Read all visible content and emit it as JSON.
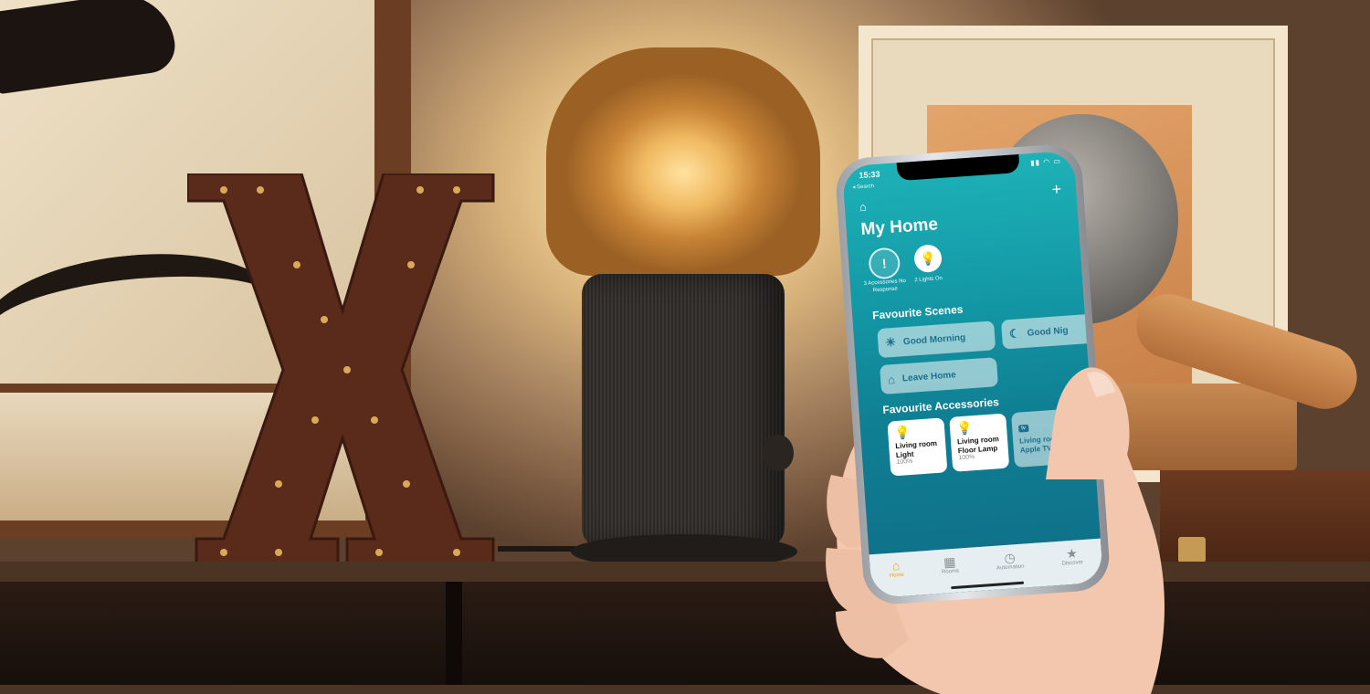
{
  "status_bar": {
    "time": "15:33",
    "back": "◂ Search"
  },
  "app": {
    "title": "My Home",
    "status": [
      {
        "caption": "3 Accessories No Response",
        "icon": "!"
      },
      {
        "caption": "2 Lights On",
        "icon": "💡"
      }
    ],
    "favourite_scenes_label": "Favourite Scenes",
    "scenes": [
      {
        "label": "Good Morning",
        "icon": "sunrise-home-icon"
      },
      {
        "label": "Good Nig",
        "icon": "moon-home-icon"
      },
      {
        "label": "Leave Home",
        "icon": "person-leaving-home-icon"
      }
    ],
    "favourite_accessories_label": "Favourite Accessories",
    "accessories": [
      {
        "name": "Living room Light",
        "value": "100%",
        "state": "on"
      },
      {
        "name": "Living room Floor Lamp",
        "value": "100%",
        "state": "on"
      },
      {
        "name": "Living room Apple TV",
        "badge": "tv",
        "state": "off"
      }
    ],
    "tabs": [
      {
        "label": "Home",
        "active": true
      },
      {
        "label": "Rooms"
      },
      {
        "label": "Automation"
      },
      {
        "label": "Discover"
      }
    ]
  },
  "colors": {
    "accent": "#f39c12",
    "screen_top": "#1db2b7",
    "screen_bottom": "#0f6e87",
    "bulb": "#f6b400"
  }
}
